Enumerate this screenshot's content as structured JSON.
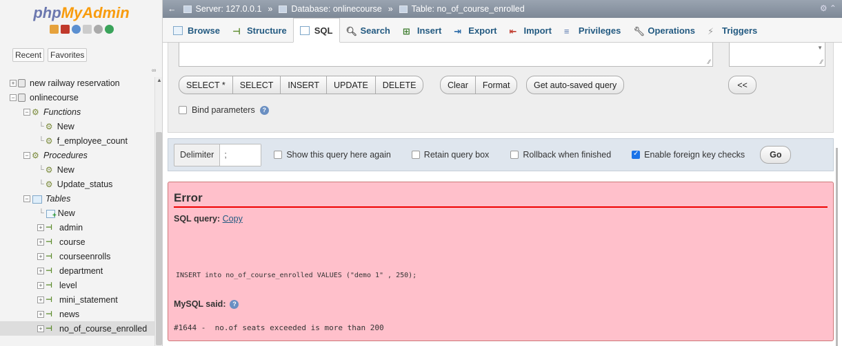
{
  "logo": {
    "php": "php",
    "myadmin": "MyAdmin"
  },
  "nav": {
    "tab_recent": "Recent",
    "tab_favorites": "Favorites",
    "tree": [
      {
        "label": "new railway reservation",
        "level": 0,
        "kind": "db"
      },
      {
        "label": "onlinecourse",
        "level": 0,
        "kind": "db"
      },
      {
        "label": "Functions",
        "level": 1,
        "kind": "group"
      },
      {
        "label": "New",
        "level": 2,
        "kind": "new-fn"
      },
      {
        "label": "f_employee_count",
        "level": 2,
        "kind": "fn"
      },
      {
        "label": "Procedures",
        "level": 1,
        "kind": "group"
      },
      {
        "label": "New",
        "level": 2,
        "kind": "new-fn"
      },
      {
        "label": "Update_status",
        "level": 2,
        "kind": "fn"
      },
      {
        "label": "Tables",
        "level": 1,
        "kind": "tables"
      },
      {
        "label": "New",
        "level": 2,
        "kind": "new"
      },
      {
        "label": "admin",
        "level": 2,
        "kind": "table"
      },
      {
        "label": "course",
        "level": 2,
        "kind": "table"
      },
      {
        "label": "courseenrolls",
        "level": 2,
        "kind": "table"
      },
      {
        "label": "department",
        "level": 2,
        "kind": "table"
      },
      {
        "label": "level",
        "level": 2,
        "kind": "table"
      },
      {
        "label": "mini_statement",
        "level": 2,
        "kind": "table"
      },
      {
        "label": "news",
        "level": 2,
        "kind": "table"
      },
      {
        "label": "no_of_course_enrolled",
        "level": 2,
        "kind": "table"
      }
    ]
  },
  "breadcrumb": {
    "server": "Server: 127.0.0.1",
    "database": "Database: onlinecourse",
    "table": "Table: no_of_course_enrolled"
  },
  "tabs": [
    "Browse",
    "Structure",
    "SQL",
    "Search",
    "Insert",
    "Export",
    "Import",
    "Privileges",
    "Operations",
    "Triggers"
  ],
  "query_buttons": {
    "select_star": "SELECT *",
    "select": "SELECT",
    "insert": "INSERT",
    "update": "UPDATE",
    "delete": "DELETE",
    "clear": "Clear",
    "format": "Format",
    "auto_saved": "Get auto-saved query",
    "collapse": "<<"
  },
  "bind_parameters": "Bind parameters",
  "options": {
    "delimiter_label": "Delimiter",
    "delimiter_value": ";",
    "show_query": "Show this query here again",
    "retain_box": "Retain query box",
    "rollback": "Rollback when finished",
    "foreign_key": "Enable foreign key checks",
    "go": "Go"
  },
  "error": {
    "title": "Error",
    "sql_query_label": "SQL query:",
    "copy_link": "Copy",
    "query": "INSERT into no_of_course_enrolled VALUES (\"demo 1\" , 250);",
    "mysql_said": "MySQL said:",
    "message": "#1644 -  no.of seats exceeded is more than 200"
  }
}
